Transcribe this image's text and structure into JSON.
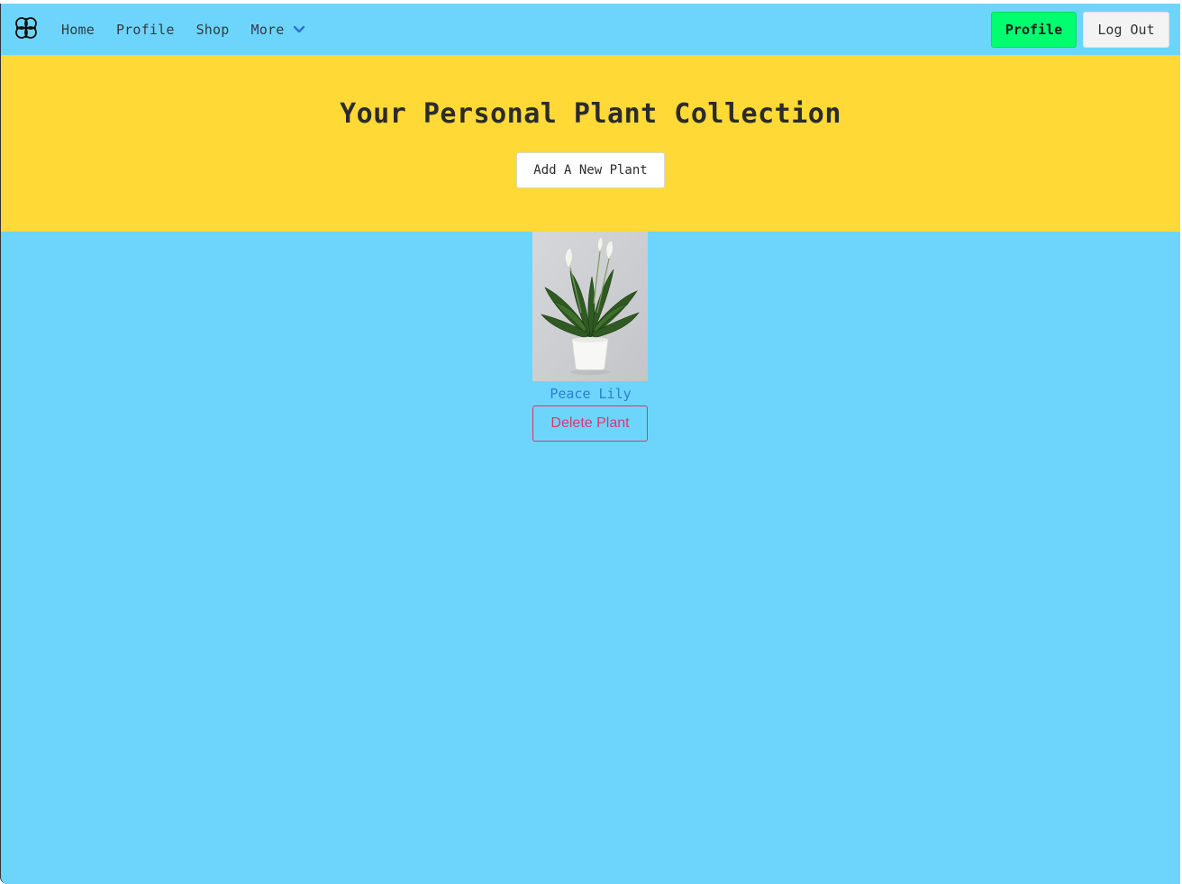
{
  "nav": {
    "links": [
      "Home",
      "Profile",
      "Shop",
      "More"
    ],
    "profile_button": "Profile",
    "logout_button": "Log Out"
  },
  "hero": {
    "title": "Your Personal Plant Collection",
    "add_button": "Add A New Plant"
  },
  "plants": [
    {
      "name": "Peace Lily",
      "delete_label": "Delete Plant"
    }
  ],
  "colors": {
    "background": "#6dd5fb",
    "hero": "#ffd936",
    "profile_button": "#00ff6e",
    "delete_accent": "#e0346c",
    "plant_name": "#2a7fcf"
  }
}
